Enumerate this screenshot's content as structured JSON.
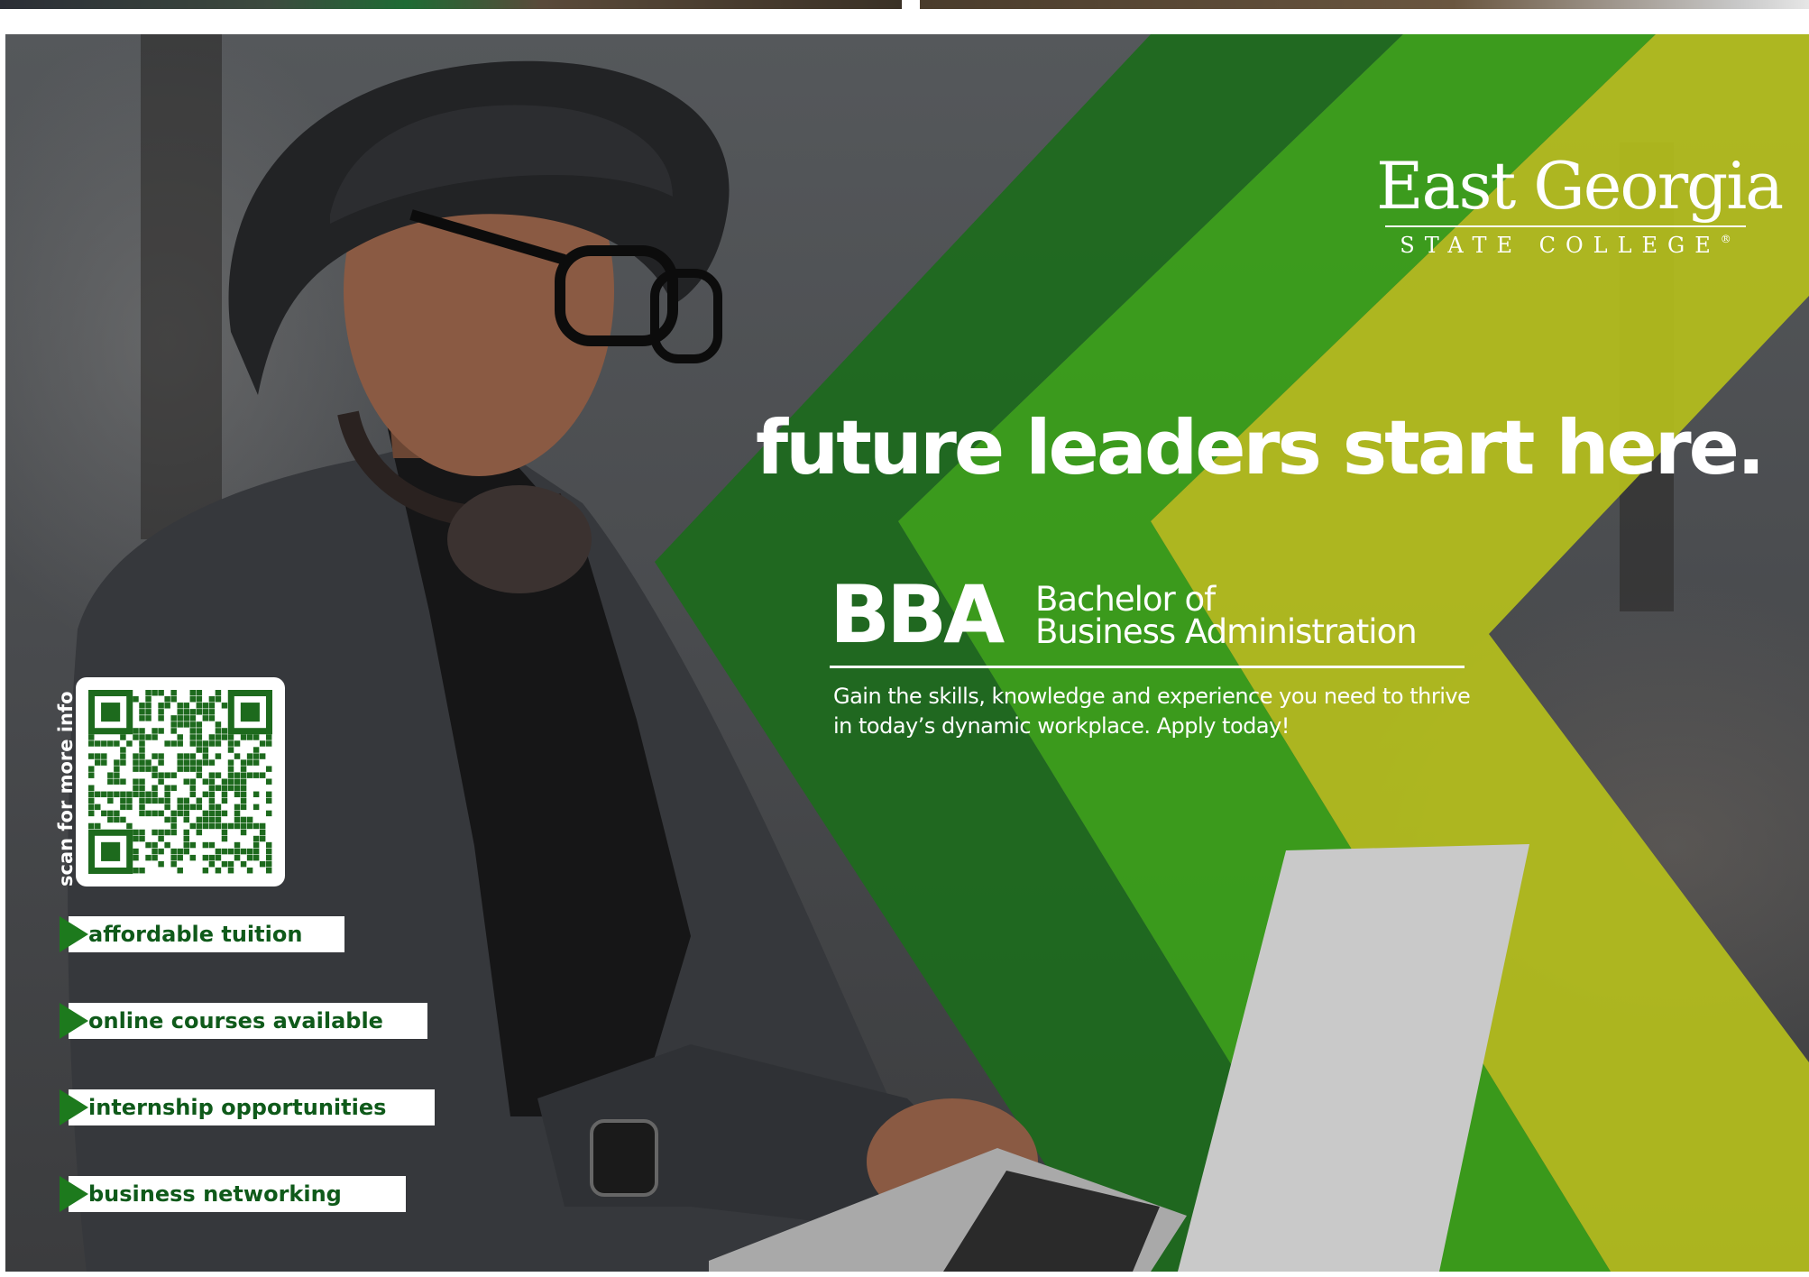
{
  "brand": {
    "colors": {
      "dark_green": "#1d6a1d",
      "mid_green": "#3aa019",
      "yellow_green": "#b7c11c",
      "white": "#ffffff"
    },
    "logo": {
      "name": "East Georgia",
      "subtitle": "STATE COLLEGE",
      "trademark": "®"
    }
  },
  "headline": "future leaders start here.",
  "program": {
    "abbreviation": "BBA",
    "name_line1": "Bachelor of",
    "name_line2": "Business Administration",
    "description": "Gain the skills, knowledge and experience you need to thrive in today’s dynamic workplace. Apply today!"
  },
  "qr": {
    "caption": "scan for more info",
    "icon": "qr-code-icon"
  },
  "features": [
    {
      "label": "affordable tuition"
    },
    {
      "label": "online courses available"
    },
    {
      "label": "internship opportunities"
    },
    {
      "label": "business networking"
    }
  ]
}
